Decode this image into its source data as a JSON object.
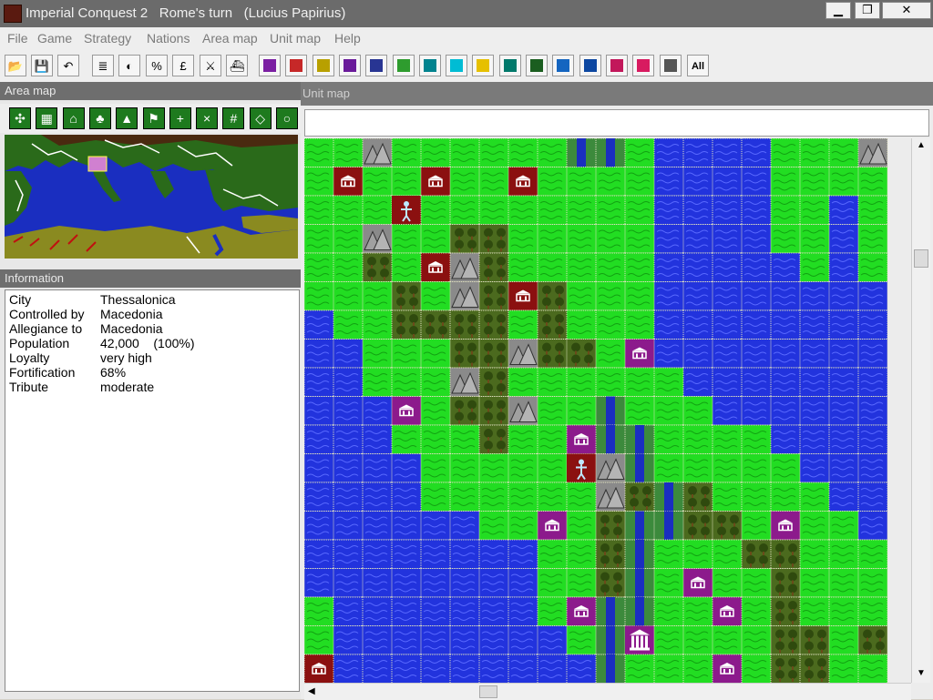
{
  "title": "Imperial Conquest 2   Rome's turn   (Lucius Papirius)",
  "window_buttons": {
    "minimize": "▁",
    "maximize": "❐",
    "close": "✕"
  },
  "menus": [
    "File",
    "Game",
    "Strategy",
    "Nations",
    "Area map",
    "Unit map",
    "Help"
  ],
  "toolbar": {
    "tools": [
      {
        "icon": "open-folder-icon",
        "glyph": "📂"
      },
      {
        "icon": "save-icon",
        "glyph": "💾"
      },
      {
        "icon": "undo-icon",
        "glyph": "↶"
      },
      {
        "icon": "report-icon",
        "glyph": "≣"
      },
      {
        "icon": "contrast-icon",
        "glyph": "◐"
      },
      {
        "icon": "percent-icon",
        "glyph": "%"
      },
      {
        "icon": "pound-icon",
        "glyph": "£"
      },
      {
        "icon": "crossed-swords-icon",
        "glyph": "⚔"
      },
      {
        "icon": "ship-icon",
        "glyph": "⛴"
      }
    ],
    "nations": [
      {
        "color": "#7b1fa2"
      },
      {
        "color": "#c62828"
      },
      {
        "color": "#b8a000"
      },
      {
        "color": "#6a1b9a"
      },
      {
        "color": "#283593"
      },
      {
        "color": "#2e9c2e"
      },
      {
        "color": "#00838f"
      },
      {
        "color": "#00bcd4"
      },
      {
        "color": "#e6c000"
      },
      {
        "color": "#00796b"
      },
      {
        "color": "#1b5e20"
      },
      {
        "color": "#1565c0"
      },
      {
        "color": "#0d47a1"
      },
      {
        "color": "#c2185b"
      },
      {
        "color": "#d81b60"
      },
      {
        "color": "#555555"
      }
    ],
    "all_label": "All"
  },
  "area_map": {
    "title": "Area map",
    "tools": [
      {
        "icon": "center-icon",
        "glyph": "✣"
      },
      {
        "icon": "city-view-icon",
        "glyph": "▦"
      },
      {
        "icon": "temple-icon",
        "glyph": "⌂"
      },
      {
        "icon": "forest-icon",
        "glyph": "♣"
      },
      {
        "icon": "hills-icon",
        "glyph": "▲"
      },
      {
        "icon": "legion-icon",
        "glyph": "⚑"
      },
      {
        "icon": "plus-grid-icon",
        "glyph": "+"
      },
      {
        "icon": "x-grid-icon",
        "glyph": "×"
      },
      {
        "icon": "hash-grid-icon",
        "glyph": "#"
      },
      {
        "icon": "diamond-icon",
        "glyph": "◇"
      },
      {
        "icon": "circle-icon",
        "glyph": "○"
      }
    ]
  },
  "information": {
    "title": "Information",
    "rows": [
      {
        "label": "City",
        "value": "Thessalonica"
      },
      {
        "label": "Controlled by",
        "value": "Macedonia"
      },
      {
        "label": "Allegiance to",
        "value": "Macedonia"
      },
      {
        "label": "Population",
        "value": "42,000    (100%)"
      },
      {
        "label": "Loyalty",
        "value": "very high"
      },
      {
        "label": "Fortification",
        "value": "68%"
      },
      {
        "label": "Tribute",
        "value": "moderate"
      }
    ]
  },
  "unit_map": {
    "title": "Unit map",
    "legend": {
      "P": "plains",
      "W": "water",
      "F": "forest",
      "M": "mountain",
      "R": "river",
      "C": "purple city",
      "D": "red city",
      "U": "unit",
      "T": "capital temple"
    },
    "colors": {
      "plains": "#22dd22",
      "water": "#2233dd",
      "forest": "#4b6a1e",
      "mountain": "#8a8a8a",
      "river_bg": "#3c8a3c",
      "purple_city": "#8c1a8c",
      "red_city": "#8b1010",
      "grid": "#e0e0c0"
    },
    "rows": [
      "PPMPPPPPPRRPWWWWPPPM",
      "PDPPDPPDPPPPWWWWPPPP",
      "PPPUPPPPPPPPWWWWPPWP",
      "PPMPPFFPPPPPWWWWPPWP",
      "PPFPDMFPPPPPWWWWWPWP",
      "PPPFPMFDFPPPWWWWWWWW",
      "WPPFFFFPFPPPWWWWWWWW",
      "WWPPPFFMFFPCWWWWWWWW",
      "WWPPPMFPPPPPPWWWWWWW",
      "WWWCPFFMPPRPPPWWWWWW",
      "WWWPPPFPPCRRPPPPWWWW",
      "WWWWPPPPPUMRPPPPPWWW",
      "WWWWPPPPPPMFRFPPPPWW",
      "WWWWWWPPCPFRRFFPCPPW",
      "WWWWWWWWPPFRPPPFFPPP",
      "WWWWWWWWPPFRPCPPFPPP",
      "PWWWWWWWPCRRPPCPFPPP",
      "PWWWWWWWWPRTPPPPFFPF",
      "DWWWWWWWWWRPPPCPFFPP"
    ]
  }
}
